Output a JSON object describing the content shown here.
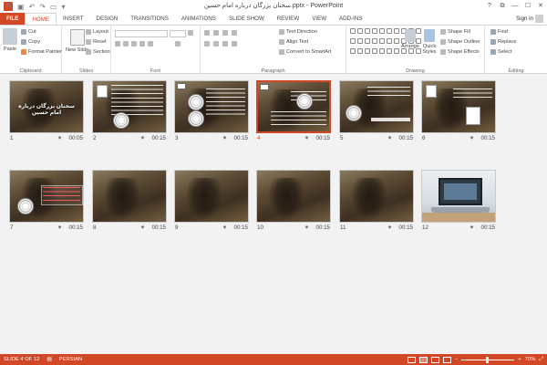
{
  "window": {
    "title": "سخنان بزرگان درباره امام حسین.pptx - PowerPoint",
    "app_logo": "P",
    "qat_icons": [
      "save-icon",
      "undo-icon",
      "redo-icon",
      "start-from-beginning-icon",
      "customize-qat-icon"
    ],
    "controls": [
      "?",
      "⧉",
      "—",
      "☐",
      "✕"
    ]
  },
  "tabs": [
    "FILE",
    "HOME",
    "INSERT",
    "DESIGN",
    "TRANSITIONS",
    "ANIMATIONS",
    "SLIDE SHOW",
    "REVIEW",
    "VIEW",
    "ADD-INS"
  ],
  "active_tab": "HOME",
  "sign_in": "Sign in",
  "ribbon": {
    "clipboard": {
      "label": "Clipboard",
      "paste": "Paste",
      "cut": "Cut",
      "copy": "Copy",
      "format_painter": "Format Painter"
    },
    "slides": {
      "label": "Slides",
      "new_slide": "New Slide",
      "layout": "Layout",
      "reset": "Reset",
      "section": "Section"
    },
    "font": {
      "label": "Font"
    },
    "paragraph": {
      "label": "Paragraph",
      "text_direction": "Text Direction",
      "align_text": "Align Text",
      "convert_smartart": "Convert to SmartArt"
    },
    "drawing": {
      "label": "Drawing",
      "arrange": "Arrange",
      "quick_styles": "Quick Styles",
      "shape_fill": "Shape Fill",
      "shape_outline": "Shape Outline",
      "shape_effects": "Shape Effects"
    },
    "editing": {
      "label": "Editing",
      "find": "Find",
      "replace": "Replace",
      "select": "Select"
    }
  },
  "slides": [
    {
      "num": "1",
      "duration": "00:05",
      "title": "سخنان بزرگان درباره امام حسین"
    },
    {
      "num": "2",
      "duration": "00:15"
    },
    {
      "num": "3",
      "duration": "00:15"
    },
    {
      "num": "4",
      "duration": "00:15",
      "selected": true
    },
    {
      "num": "5",
      "duration": "00:15"
    },
    {
      "num": "6",
      "duration": "00:15"
    },
    {
      "num": "7",
      "duration": "00:15"
    },
    {
      "num": "8",
      "duration": "00:15"
    },
    {
      "num": "9",
      "duration": "00:15"
    },
    {
      "num": "10",
      "duration": "00:15"
    },
    {
      "num": "11",
      "duration": "00:15"
    },
    {
      "num": "12",
      "duration": "00:15"
    }
  ],
  "status": {
    "slide_info": "SLIDE 4 OF 12",
    "language": "PERSIAN",
    "zoom": "70%"
  },
  "colors": {
    "accent": "#d24726",
    "sorter_bg": "#f2f2f2"
  }
}
